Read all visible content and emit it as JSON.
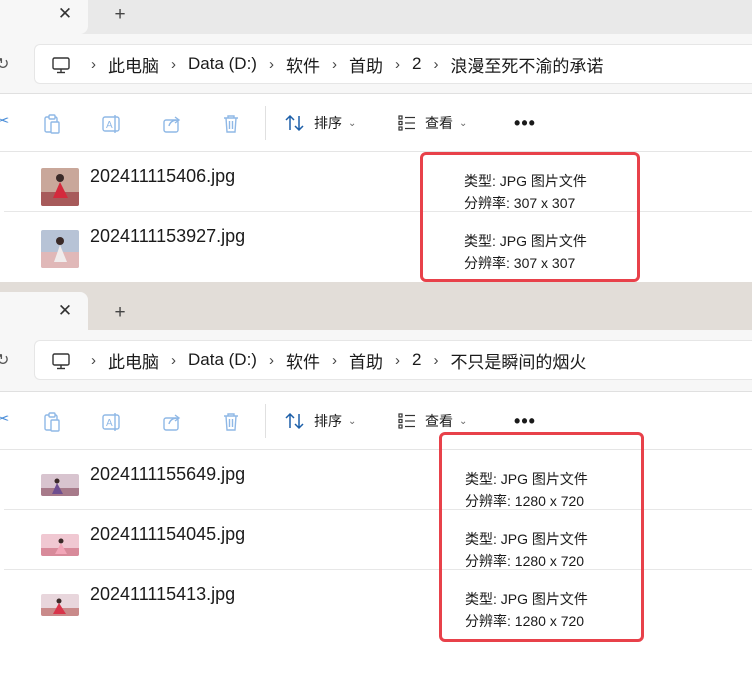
{
  "colors": {
    "highlight": "#e8414a",
    "accent": "#4a8dd8"
  },
  "windows": [
    {
      "tab": {
        "close_icon": "close-icon",
        "new_tab": "+"
      },
      "breadcrumb": [
        "此电脑",
        "Data (D:)",
        "软件",
        "首助",
        "2",
        "浪漫至死不渝的承诺"
      ],
      "toolbar": {
        "sort_label": "排序",
        "view_label": "查看",
        "more_label": "•••"
      },
      "files": [
        {
          "name": "202411115406.jpg",
          "type": "类型: JPG 图片文件",
          "resolution": "分辨率: 307 x 307"
        },
        {
          "name": "2024111153927.jpg",
          "type": "类型: JPG 图片文件",
          "resolution": "分辨率: 307 x 307"
        }
      ]
    },
    {
      "tab": {
        "close_icon": "close-icon",
        "new_tab": "+"
      },
      "breadcrumb": [
        "此电脑",
        "Data (D:)",
        "软件",
        "首助",
        "2",
        "不只是瞬间的烟火"
      ],
      "toolbar": {
        "sort_label": "排序",
        "view_label": "查看",
        "more_label": "•••"
      },
      "files": [
        {
          "name": "2024111155649.jpg",
          "type": "类型: JPG 图片文件",
          "resolution": "分辨率: 1280 x 720"
        },
        {
          "name": "2024111154045.jpg",
          "type": "类型: JPG 图片文件",
          "resolution": "分辨率: 1280 x 720"
        },
        {
          "name": "202411115413.jpg",
          "type": "类型: JPG 图片文件",
          "resolution": "分辨率: 1280 x 720"
        }
      ]
    }
  ]
}
